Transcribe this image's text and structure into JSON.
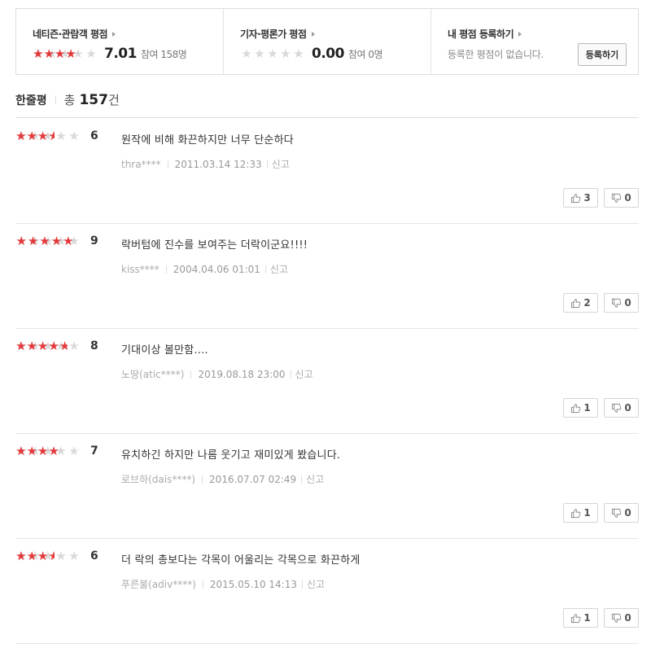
{
  "summary": {
    "netizen": {
      "title": "네티즌·관람객 평점",
      "score": "7.01",
      "participants": "참여 158명",
      "rating_fraction": 0.7
    },
    "critic": {
      "title": "기자·평론가 평점",
      "score": "0.00",
      "participants": "참여 0명",
      "rating_fraction": 0.0
    },
    "mine": {
      "title": "내 평점 등록하기",
      "empty_text": "등록한 평점이 없습니다.",
      "register_label": "등록하기"
    }
  },
  "list": {
    "title": "한줄평",
    "total_label": "총",
    "count": "157",
    "unit": "건"
  },
  "star_char": "★",
  "reviews": [
    {
      "rating_fraction": 0.6,
      "score": "6",
      "text": "원작에 비해 화끈하지만 너무 단순하다",
      "user": "thra****",
      "date": "2011.03.14 12:33",
      "report": "신고",
      "likes": "3",
      "dislikes": "0"
    },
    {
      "rating_fraction": 0.9,
      "score": "9",
      "text": "락버텀에 진수를 보여주는 더락이군요!!!!",
      "user": "kiss****",
      "date": "2004.04.06 01:01",
      "report": "신고",
      "likes": "2",
      "dislikes": "0"
    },
    {
      "rating_fraction": 0.8,
      "score": "8",
      "text": "기대이상 볼만함....",
      "user": "노땅(atic****)",
      "date": "2019.08.18 23:00",
      "report": "신고",
      "likes": "1",
      "dislikes": "0"
    },
    {
      "rating_fraction": 0.7,
      "score": "7",
      "text": "유치하긴 하지만 나름 웃기고 재미있게 봤습니다.",
      "user": "로브하(dais****)",
      "date": "2016.07.07 02:49",
      "report": "신고",
      "likes": "1",
      "dislikes": "0"
    },
    {
      "rating_fraction": 0.6,
      "score": "6",
      "text": "더 락의 총보다는 각목이 어울리는 각목으로 화끈하게",
      "user": "푸른불(adiv****)",
      "date": "2015.05.10 14:13",
      "report": "신고",
      "likes": "1",
      "dislikes": "0"
    }
  ]
}
